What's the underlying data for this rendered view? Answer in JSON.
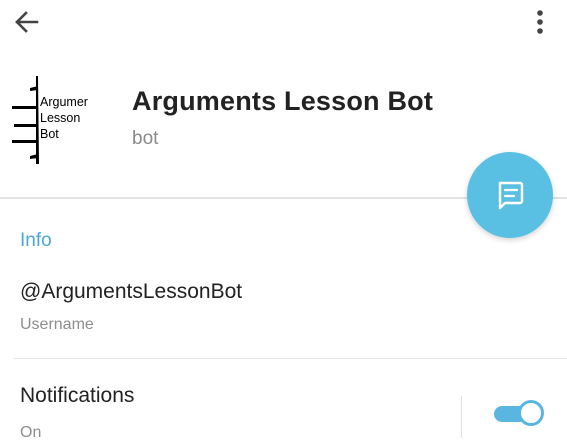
{
  "header": {
    "back_icon": "arrow-left-icon",
    "menu_icon": "more-vertical-icon"
  },
  "profile": {
    "avatar_lines": [
      "Argumer",
      "Lesson",
      "Bot"
    ],
    "name": "Arguments Lesson Bot",
    "subtitle": "bot"
  },
  "fab": {
    "icon": "message-icon",
    "color": "#5ac0e3"
  },
  "info": {
    "section_title": "Info",
    "username_value": "@ArgumentsLessonBot",
    "username_label": "Username"
  },
  "notifications": {
    "title": "Notifications",
    "status": "On",
    "enabled": true
  },
  "colors": {
    "accent": "#4aa8d8",
    "toggle": "#5ab6e0"
  }
}
